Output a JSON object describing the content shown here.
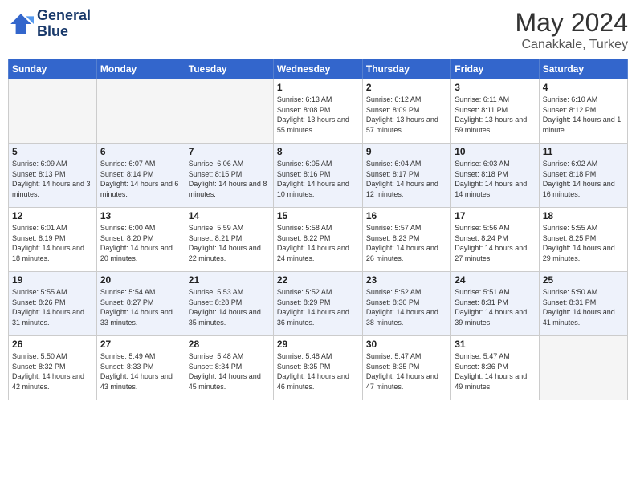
{
  "header": {
    "logo_line1": "General",
    "logo_line2": "Blue",
    "month": "May 2024",
    "location": "Canakkale, Turkey"
  },
  "weekdays": [
    "Sunday",
    "Monday",
    "Tuesday",
    "Wednesday",
    "Thursday",
    "Friday",
    "Saturday"
  ],
  "weeks": [
    [
      {
        "day": "",
        "sunrise": "",
        "sunset": "",
        "daylight": "",
        "empty": true
      },
      {
        "day": "",
        "sunrise": "",
        "sunset": "",
        "daylight": "",
        "empty": true
      },
      {
        "day": "",
        "sunrise": "",
        "sunset": "",
        "daylight": "",
        "empty": true
      },
      {
        "day": "1",
        "sunrise": "Sunrise: 6:13 AM",
        "sunset": "Sunset: 8:08 PM",
        "daylight": "Daylight: 13 hours and 55 minutes."
      },
      {
        "day": "2",
        "sunrise": "Sunrise: 6:12 AM",
        "sunset": "Sunset: 8:09 PM",
        "daylight": "Daylight: 13 hours and 57 minutes."
      },
      {
        "day": "3",
        "sunrise": "Sunrise: 6:11 AM",
        "sunset": "Sunset: 8:11 PM",
        "daylight": "Daylight: 13 hours and 59 minutes."
      },
      {
        "day": "4",
        "sunrise": "Sunrise: 6:10 AM",
        "sunset": "Sunset: 8:12 PM",
        "daylight": "Daylight: 14 hours and 1 minute."
      }
    ],
    [
      {
        "day": "5",
        "sunrise": "Sunrise: 6:09 AM",
        "sunset": "Sunset: 8:13 PM",
        "daylight": "Daylight: 14 hours and 3 minutes."
      },
      {
        "day": "6",
        "sunrise": "Sunrise: 6:07 AM",
        "sunset": "Sunset: 8:14 PM",
        "daylight": "Daylight: 14 hours and 6 minutes."
      },
      {
        "day": "7",
        "sunrise": "Sunrise: 6:06 AM",
        "sunset": "Sunset: 8:15 PM",
        "daylight": "Daylight: 14 hours and 8 minutes."
      },
      {
        "day": "8",
        "sunrise": "Sunrise: 6:05 AM",
        "sunset": "Sunset: 8:16 PM",
        "daylight": "Daylight: 14 hours and 10 minutes."
      },
      {
        "day": "9",
        "sunrise": "Sunrise: 6:04 AM",
        "sunset": "Sunset: 8:17 PM",
        "daylight": "Daylight: 14 hours and 12 minutes."
      },
      {
        "day": "10",
        "sunrise": "Sunrise: 6:03 AM",
        "sunset": "Sunset: 8:18 PM",
        "daylight": "Daylight: 14 hours and 14 minutes."
      },
      {
        "day": "11",
        "sunrise": "Sunrise: 6:02 AM",
        "sunset": "Sunset: 8:18 PM",
        "daylight": "Daylight: 14 hours and 16 minutes."
      }
    ],
    [
      {
        "day": "12",
        "sunrise": "Sunrise: 6:01 AM",
        "sunset": "Sunset: 8:19 PM",
        "daylight": "Daylight: 14 hours and 18 minutes."
      },
      {
        "day": "13",
        "sunrise": "Sunrise: 6:00 AM",
        "sunset": "Sunset: 8:20 PM",
        "daylight": "Daylight: 14 hours and 20 minutes."
      },
      {
        "day": "14",
        "sunrise": "Sunrise: 5:59 AM",
        "sunset": "Sunset: 8:21 PM",
        "daylight": "Daylight: 14 hours and 22 minutes."
      },
      {
        "day": "15",
        "sunrise": "Sunrise: 5:58 AM",
        "sunset": "Sunset: 8:22 PM",
        "daylight": "Daylight: 14 hours and 24 minutes."
      },
      {
        "day": "16",
        "sunrise": "Sunrise: 5:57 AM",
        "sunset": "Sunset: 8:23 PM",
        "daylight": "Daylight: 14 hours and 26 minutes."
      },
      {
        "day": "17",
        "sunrise": "Sunrise: 5:56 AM",
        "sunset": "Sunset: 8:24 PM",
        "daylight": "Daylight: 14 hours and 27 minutes."
      },
      {
        "day": "18",
        "sunrise": "Sunrise: 5:55 AM",
        "sunset": "Sunset: 8:25 PM",
        "daylight": "Daylight: 14 hours and 29 minutes."
      }
    ],
    [
      {
        "day": "19",
        "sunrise": "Sunrise: 5:55 AM",
        "sunset": "Sunset: 8:26 PM",
        "daylight": "Daylight: 14 hours and 31 minutes."
      },
      {
        "day": "20",
        "sunrise": "Sunrise: 5:54 AM",
        "sunset": "Sunset: 8:27 PM",
        "daylight": "Daylight: 14 hours and 33 minutes."
      },
      {
        "day": "21",
        "sunrise": "Sunrise: 5:53 AM",
        "sunset": "Sunset: 8:28 PM",
        "daylight": "Daylight: 14 hours and 35 minutes."
      },
      {
        "day": "22",
        "sunrise": "Sunrise: 5:52 AM",
        "sunset": "Sunset: 8:29 PM",
        "daylight": "Daylight: 14 hours and 36 minutes."
      },
      {
        "day": "23",
        "sunrise": "Sunrise: 5:52 AM",
        "sunset": "Sunset: 8:30 PM",
        "daylight": "Daylight: 14 hours and 38 minutes."
      },
      {
        "day": "24",
        "sunrise": "Sunrise: 5:51 AM",
        "sunset": "Sunset: 8:31 PM",
        "daylight": "Daylight: 14 hours and 39 minutes."
      },
      {
        "day": "25",
        "sunrise": "Sunrise: 5:50 AM",
        "sunset": "Sunset: 8:31 PM",
        "daylight": "Daylight: 14 hours and 41 minutes."
      }
    ],
    [
      {
        "day": "26",
        "sunrise": "Sunrise: 5:50 AM",
        "sunset": "Sunset: 8:32 PM",
        "daylight": "Daylight: 14 hours and 42 minutes."
      },
      {
        "day": "27",
        "sunrise": "Sunrise: 5:49 AM",
        "sunset": "Sunset: 8:33 PM",
        "daylight": "Daylight: 14 hours and 43 minutes."
      },
      {
        "day": "28",
        "sunrise": "Sunrise: 5:48 AM",
        "sunset": "Sunset: 8:34 PM",
        "daylight": "Daylight: 14 hours and 45 minutes."
      },
      {
        "day": "29",
        "sunrise": "Sunrise: 5:48 AM",
        "sunset": "Sunset: 8:35 PM",
        "daylight": "Daylight: 14 hours and 46 minutes."
      },
      {
        "day": "30",
        "sunrise": "Sunrise: 5:47 AM",
        "sunset": "Sunset: 8:35 PM",
        "daylight": "Daylight: 14 hours and 47 minutes."
      },
      {
        "day": "31",
        "sunrise": "Sunrise: 5:47 AM",
        "sunset": "Sunset: 8:36 PM",
        "daylight": "Daylight: 14 hours and 49 minutes."
      },
      {
        "day": "",
        "sunrise": "",
        "sunset": "",
        "daylight": "",
        "empty": true
      }
    ]
  ]
}
